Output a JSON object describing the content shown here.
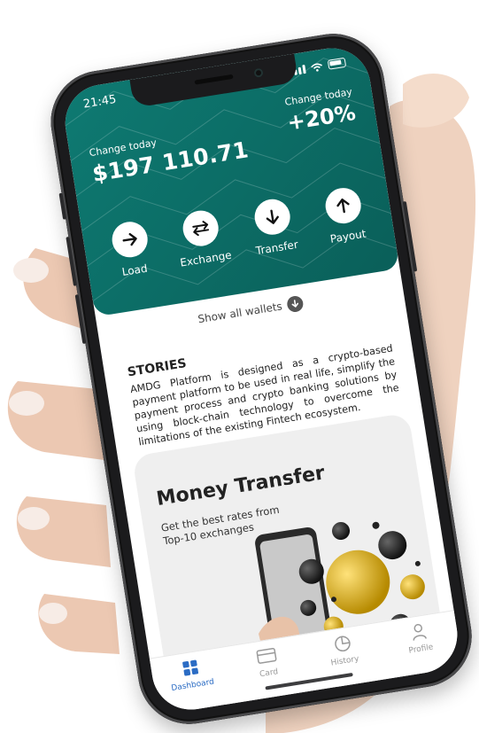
{
  "status": {
    "time": "21:45"
  },
  "header": {
    "change_left_label": "Change today",
    "balance": "$197 110.71",
    "change_right_label": "Change today",
    "percent": "+20%",
    "actions": [
      {
        "label": "Load",
        "icon": "arrow-right-icon"
      },
      {
        "label": "Exchange",
        "icon": "exchange-arrows-icon"
      },
      {
        "label": "Transfer",
        "icon": "arrow-down-icon"
      },
      {
        "label": "Payout",
        "icon": "arrow-up-icon"
      }
    ],
    "accent": "#0c6d66"
  },
  "wallets": {
    "label": "Show all wallets"
  },
  "stories": {
    "title": "STORIES",
    "text": "AMDG Platform is designed as a crypto-based payment platform to be used in real life, simplify the payment process and crypto banking solutions by using block-chain technology to overcome the limitations of the existing Fintech ecosystem."
  },
  "promo": {
    "title": "Money Transfer",
    "subtitle": "Get the best rates from Top-10 exchanges"
  },
  "tabs": [
    {
      "label": "Dashboard",
      "icon": "grid-icon",
      "active": true
    },
    {
      "label": "Card",
      "icon": "card-icon",
      "active": false
    },
    {
      "label": "History",
      "icon": "pie-chart-icon",
      "active": false
    },
    {
      "label": "Profile",
      "icon": "user-icon",
      "active": false
    }
  ],
  "colors": {
    "active_tab": "#2b6cc4",
    "teal": "#0c6d66"
  }
}
